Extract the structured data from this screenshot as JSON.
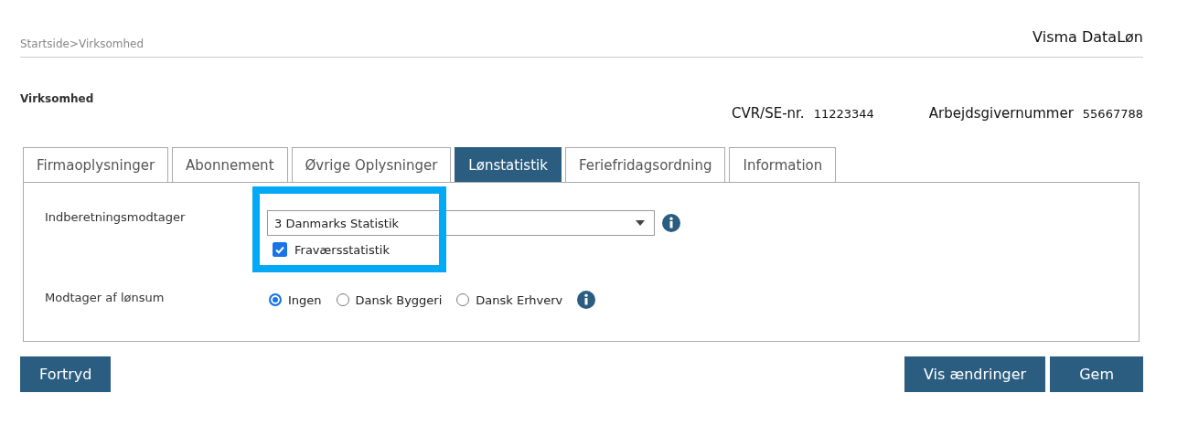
{
  "breadcrumb": {
    "items": [
      "Startside",
      "Virksomhed"
    ],
    "separator": ">"
  },
  "app_title": "Visma DataLøn",
  "section_title": "Virksomhed",
  "ids": [
    {
      "label": "CVR/SE-nr.",
      "value": "11223344"
    },
    {
      "label": "Arbejdsgivernummer",
      "value": "55667788"
    }
  ],
  "tabs": [
    {
      "label": "Firmaoplysninger",
      "selected": false
    },
    {
      "label": "Abonnement",
      "selected": false
    },
    {
      "label": "Øvrige Oplysninger",
      "selected": false
    },
    {
      "label": "Lønstatistik",
      "selected": true
    },
    {
      "label": "Feriefridagsordning",
      "selected": false
    },
    {
      "label": "Information",
      "selected": false
    }
  ],
  "form": {
    "recipient": {
      "label": "Indberetningsmodtager",
      "value": "3 Danmarks Statistik",
      "checkbox": {
        "label": "Fraværsstatistik",
        "checked": true
      }
    },
    "wage_recipient": {
      "label": "Modtager af lønsum",
      "options": [
        {
          "label": "Ingen",
          "selected": true
        },
        {
          "label": "Dansk Byggeri",
          "selected": false
        },
        {
          "label": "Dansk Erhverv",
          "selected": false
        }
      ]
    }
  },
  "buttons_left": [
    "Fortryd"
  ],
  "buttons_right": [
    "Vis ændringer",
    "Gem"
  ]
}
